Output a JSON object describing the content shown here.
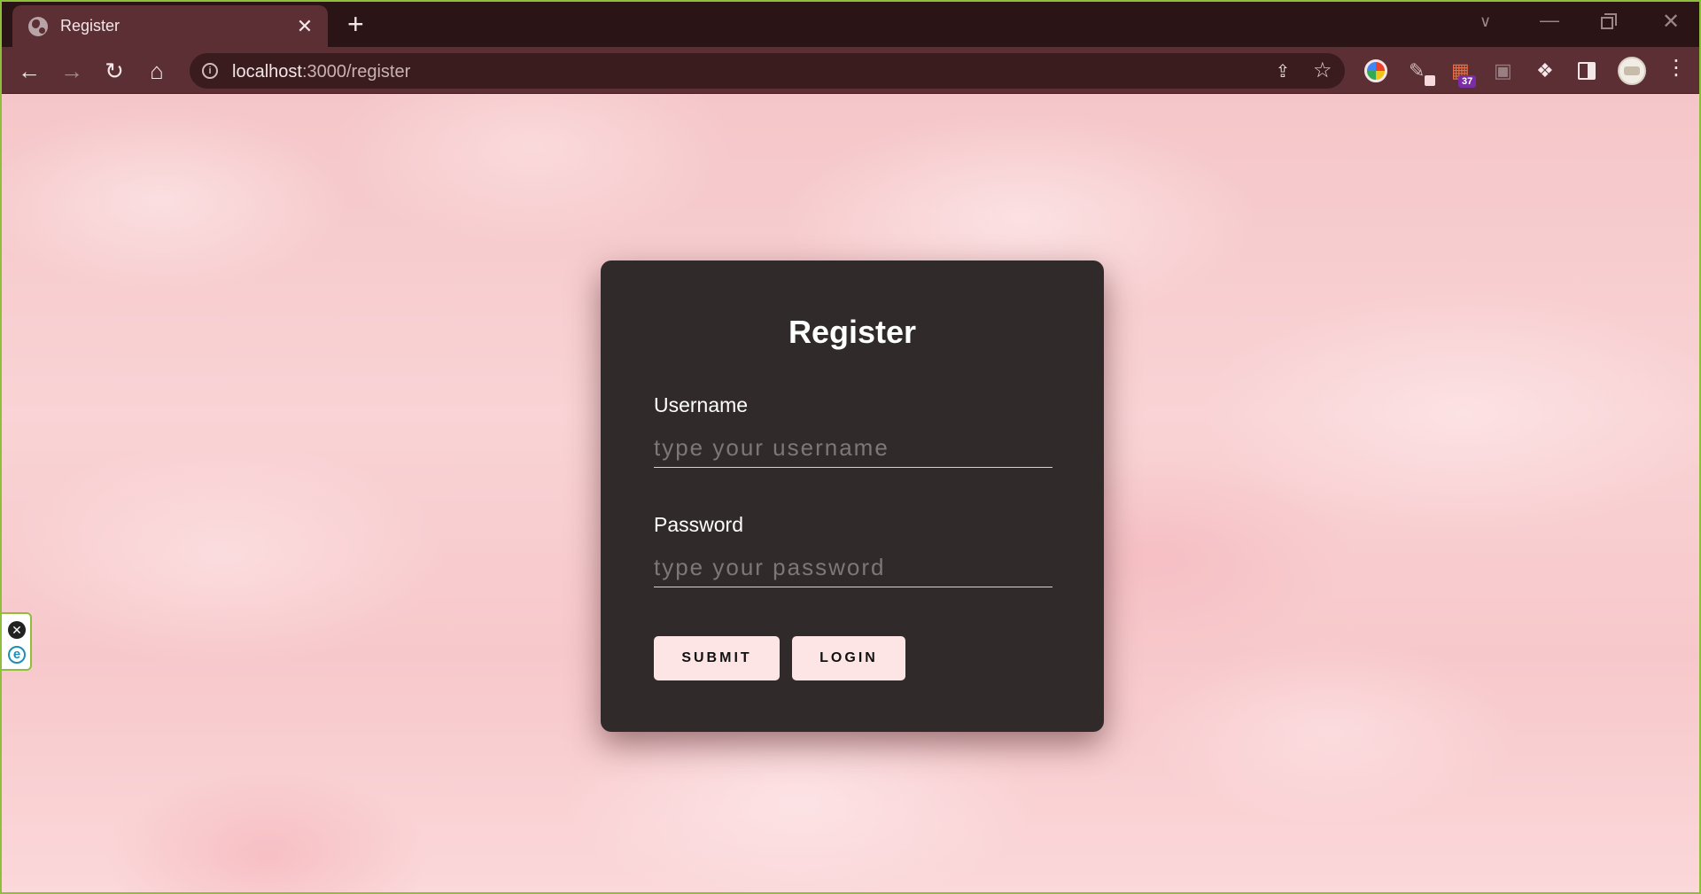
{
  "browser": {
    "tab": {
      "title": "Register",
      "close_glyph": "✕"
    },
    "new_tab_glyph": "+",
    "url_host": "localhost",
    "url_path": ":3000/register",
    "extension_badge": "37",
    "icons": {
      "favicon": "globe-icon",
      "back": "arrow-left-icon",
      "forward": "arrow-right-icon",
      "reload": "reload-icon",
      "home": "home-icon",
      "site_info": "info-icon",
      "share": "share-icon",
      "bookmark": "star-icon",
      "menu": "kebab-menu-icon"
    }
  },
  "side_widget": {
    "close_glyph": "✕",
    "app_glyph": "e"
  },
  "form": {
    "title": "Register",
    "username": {
      "label": "Username",
      "placeholder": "type your username",
      "value": ""
    },
    "password": {
      "label": "Password",
      "placeholder": "type your password",
      "value": ""
    },
    "submit_label": "SUBMIT",
    "login_label": "LOGIN"
  },
  "colors": {
    "chrome_bg": "#2a1416",
    "toolbar_bg": "#5b2f33",
    "card_bg": "#302a2b",
    "button_bg": "#fde5e6",
    "page_bg": "#f7c9cb"
  }
}
